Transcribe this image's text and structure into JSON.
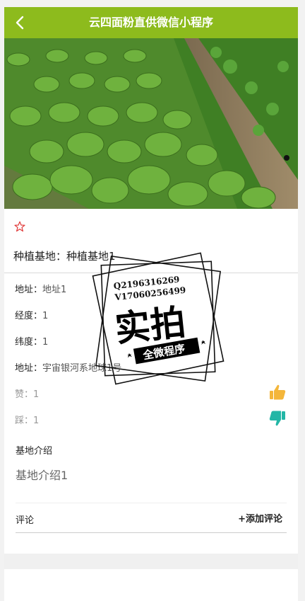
{
  "header": {
    "title": "云四面粉直供微信小程序"
  },
  "base": {
    "name_label": "种植基地：",
    "name_value": "种植基地1"
  },
  "details": [
    {
      "key": "地址：",
      "value": "地址1"
    },
    {
      "key": "经度：",
      "value": "1"
    },
    {
      "key": "纬度：",
      "value": "1"
    },
    {
      "key": "地址：",
      "value": "宇宙银河系地球1号"
    }
  ],
  "votes": {
    "like_label": "赞：",
    "like_value": "1",
    "dislike_label": "踩：",
    "dislike_value": "1"
  },
  "intro": {
    "heading": "基地介绍",
    "text": "基地介绍1"
  },
  "comments": {
    "title": "评论",
    "add_label": "+添加评论"
  },
  "watermark": {
    "line1": "Q2196316269",
    "line2": "V17060256499",
    "big": "实拍",
    "ribbon": "全微程序"
  },
  "colors": {
    "header": "#8dbb1d",
    "like": "#f4b63a",
    "dislike": "#23b6a6",
    "star": "#e03a3a"
  }
}
